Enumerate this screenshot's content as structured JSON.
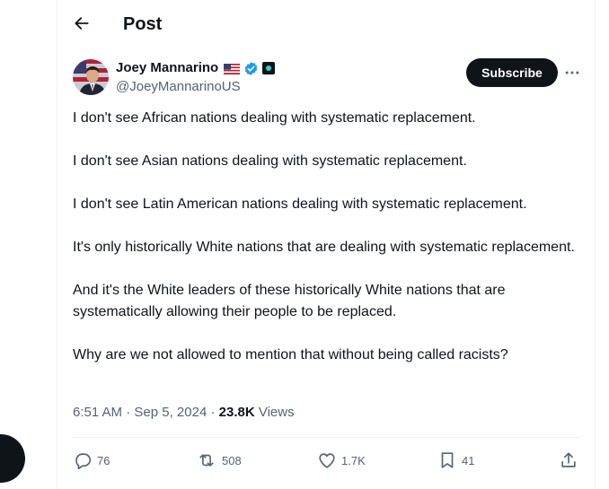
{
  "header": {
    "title": "Post"
  },
  "author": {
    "name": "Joey Mannarino",
    "handle": "@JoeyMannarinoUS"
  },
  "subscribe_label": "Subscribe",
  "paragraphs": [
    "I don't see African nations dealing with systematic replacement.",
    "I don't see Asian nations dealing with systematic replacement.",
    "I don't see Latin American nations dealing with systematic replacement.",
    "It's only historically White nations that are dealing with systematic replacement.",
    "And it's the White leaders of these historically White nations that are systematically allowing their people to be replaced.",
    "Why are we not allowed to mention that without being called racists?"
  ],
  "meta": {
    "time": "6:51 AM",
    "sep1": "·",
    "date": "Sep 5, 2024",
    "sep2": "·",
    "views_count": "23.8K",
    "views_label": "Views"
  },
  "actions": {
    "replies": "76",
    "reposts": "508",
    "likes": "1.7K",
    "bookmarks": "41"
  },
  "colors": {
    "text": "#0f1419",
    "secondary": "#536471",
    "verified": "#1d9bf0",
    "border": "#eff3f4"
  },
  "icons": {
    "back": "arrow-left-icon",
    "verified": "verified-badge-icon",
    "flag": "us-flag-icon",
    "affiliation": "affiliation-badge-icon",
    "more": "more-icon",
    "reply": "reply-icon",
    "repost": "repost-icon",
    "like": "heart-icon",
    "bookmark": "bookmark-icon",
    "share": "share-icon"
  }
}
